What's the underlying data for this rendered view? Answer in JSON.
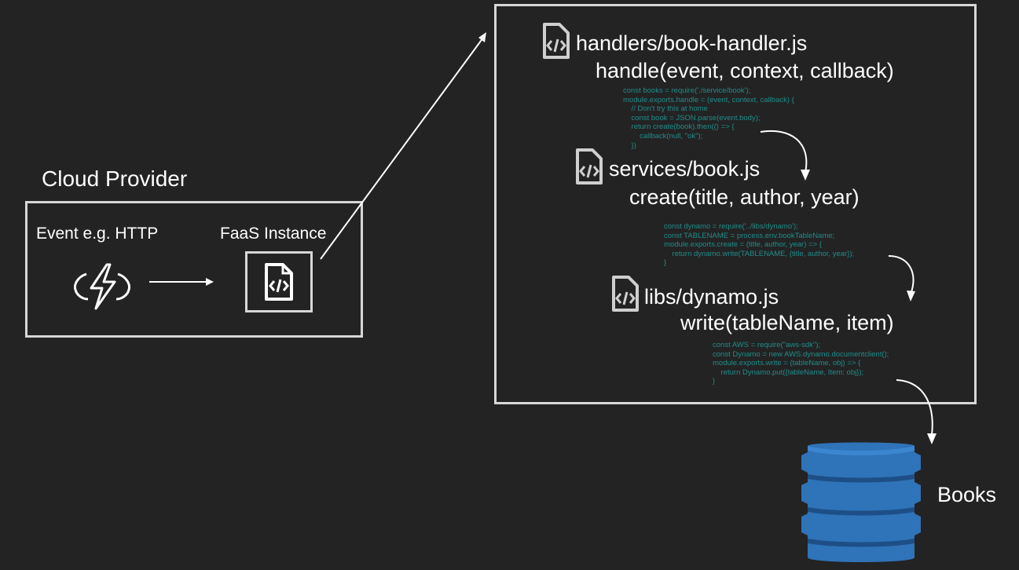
{
  "cloud_provider": {
    "title": "Cloud Provider",
    "event_label": "Event e.g. HTTP",
    "faas_label": "FaaS Instance"
  },
  "files": [
    {
      "path": "handlers/book-handler.js",
      "signature": "handle(event, context, callback)",
      "code": "const books = require('./service/book');\nmodule.exports.handle = (event, context, callback) {\n    // Don't try this at home\n    const book = JSON.parse(event.body);\n    return create(book).then(() => {\n        callback(null, \"ok\");\n    })"
    },
    {
      "path": "services/book.js",
      "signature": "create(title, author, year)",
      "code": "const dynamo = require('../libs/dynamo');\nconst TABLENAME = process.env.bookTableName;\nmodule.exports.create = (title, author, year) => {\n    return dynamo.write(TABLENAME, {title, author, year});\n}"
    },
    {
      "path": "libs/dynamo.js",
      "signature": "write(tableName, item)",
      "code": "const AWS = require(\"aws-sdk\");\nconst Dynamo = new AWS.dynamo.documentclient();\nmodule.exports.write = (tableName, obj) => {\n    return Dynamo.put({tableName, Item: obj});\n}"
    }
  ],
  "database": {
    "label": "Books"
  },
  "icons": {
    "event": "lightning-bolt-icon",
    "file": "code-file-icon",
    "database": "dynamodb-icon"
  },
  "colors": {
    "background": "#232323",
    "code": "#1f8d8a",
    "database": "#2f73b8"
  }
}
